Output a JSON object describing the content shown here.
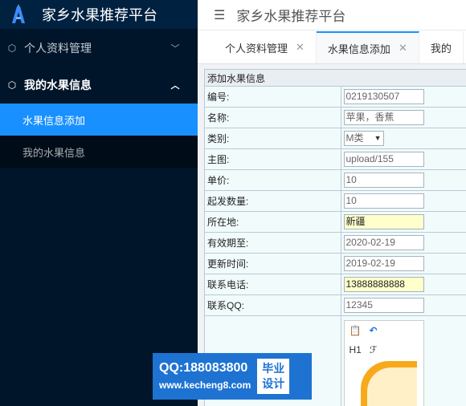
{
  "app": {
    "title": "家乡水果推荐平台"
  },
  "sidebar": {
    "groups": [
      {
        "label": "个人资料管理",
        "icon": "cube-icon",
        "expanded": false
      },
      {
        "label": "我的水果信息",
        "icon": "cube-icon",
        "expanded": true,
        "items": [
          {
            "label": "水果信息添加",
            "active": true
          },
          {
            "label": "我的水果信息",
            "active": false
          }
        ]
      }
    ]
  },
  "header": {
    "title": "家乡水果推荐平台"
  },
  "tabs": [
    {
      "label": "个人资料管理",
      "active": false
    },
    {
      "label": "水果信息添加",
      "active": true
    },
    {
      "label": "我的"
    }
  ],
  "form": {
    "caption": "添加水果信息",
    "rows": [
      {
        "label": "编号:",
        "value": "0219130507"
      },
      {
        "label": "名称:",
        "value": "苹果，香蕉"
      },
      {
        "label": "类别:",
        "value": "M类"
      },
      {
        "label": "主图:",
        "value": "upload/155"
      },
      {
        "label": "单价:",
        "value": "10"
      },
      {
        "label": "起发数量:",
        "value": "10"
      },
      {
        "label": "所在地:",
        "value": "新疆"
      },
      {
        "label": "有效期至:",
        "value": "2020-02-19"
      },
      {
        "label": "更新时间:",
        "value": "2019-02-19"
      },
      {
        "label": "联系电话:",
        "value": "13888888888"
      },
      {
        "label": "联系QQ:",
        "value": "12345"
      }
    ],
    "editor": {
      "heading_button": "H1",
      "font_button": "ℱ"
    }
  },
  "watermark": {
    "qq": "QQ:188083800",
    "url": "www.kecheng8.com",
    "badge_line1": "毕业",
    "badge_line2": "设计"
  },
  "colors": {
    "sidebar_bg": "#001529",
    "accent": "#1890ff",
    "watermark": "#1e73d2"
  }
}
